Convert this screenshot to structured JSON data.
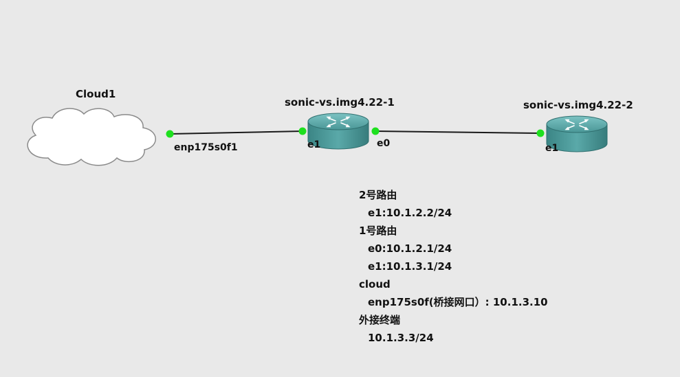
{
  "nodes": {
    "cloud": {
      "name": "Cloud1"
    },
    "router1": {
      "name": "sonic-vs.img4.22-1"
    },
    "router2": {
      "name": "sonic-vs.img4.22-2"
    }
  },
  "ports": {
    "cloud_port": "enp175s0f1",
    "router1_e1": "e1",
    "router1_e0": "e0",
    "router2_e1": "e1"
  },
  "colors": {
    "background": "#e9e9e9",
    "router_fill": "#4f9a9a",
    "link_up": "#1ee01e",
    "link_line": "#1a1a1a"
  },
  "icons": {
    "cloud": "cloud-icon",
    "router": "router-icon"
  },
  "note": {
    "lines": [
      {
        "text": "2号路由",
        "indent": false
      },
      {
        "text": "e1:10.1.2.2/24",
        "indent": true
      },
      {
        "text": "1号路由",
        "indent": false
      },
      {
        "text": "e0:10.1.2.1/24",
        "indent": true
      },
      {
        "text": "e1:10.1.3.1/24",
        "indent": true
      },
      {
        "text": "cloud",
        "indent": false
      },
      {
        "text": "enp175s0f(桥接网口）: 10.1.3.10",
        "indent": true
      },
      {
        "text": "外接终端",
        "indent": false
      },
      {
        "text": "10.1.3.3/24",
        "indent": true
      }
    ]
  }
}
